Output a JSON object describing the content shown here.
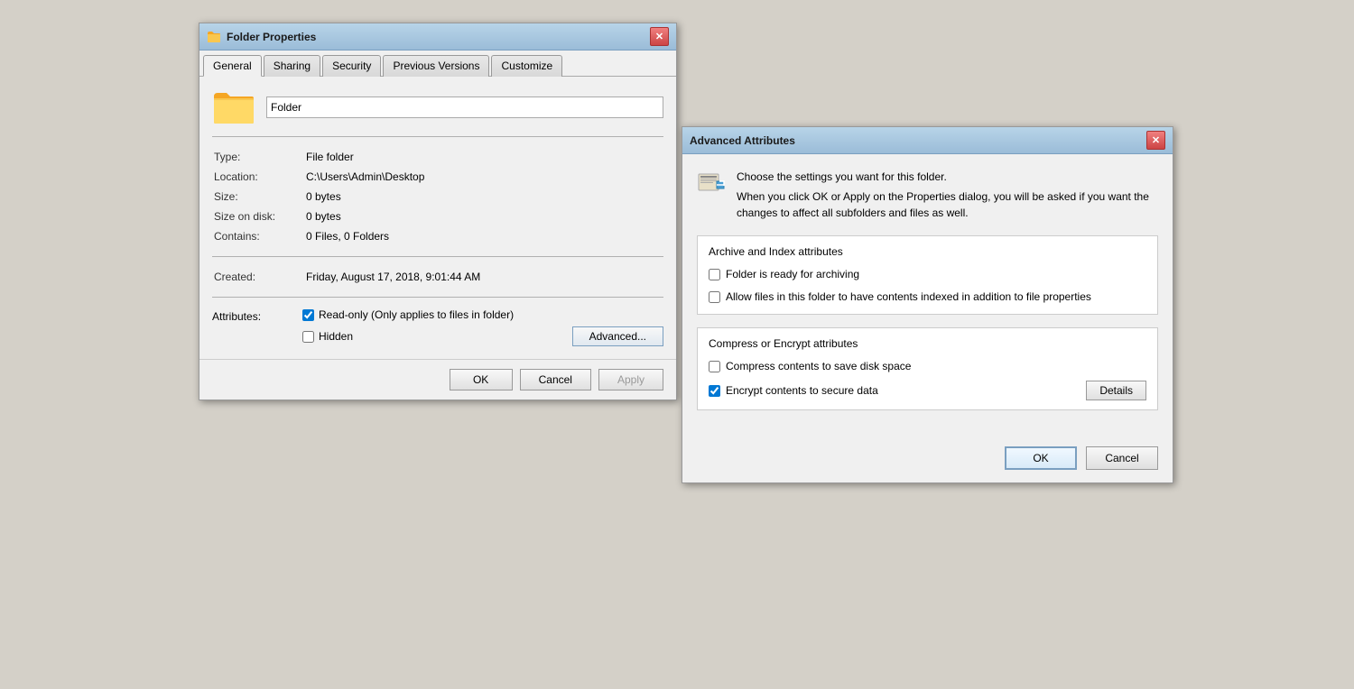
{
  "folderProps": {
    "title": "Folder Properties",
    "tabs": [
      {
        "id": "general",
        "label": "General",
        "active": true
      },
      {
        "id": "sharing",
        "label": "Sharing",
        "active": false
      },
      {
        "id": "security",
        "label": "Security",
        "active": false
      },
      {
        "id": "previous-versions",
        "label": "Previous Versions",
        "active": false
      },
      {
        "id": "customize",
        "label": "Customize",
        "active": false
      }
    ],
    "folderName": "Folder",
    "properties": {
      "type": {
        "label": "Type:",
        "value": "File folder"
      },
      "location": {
        "label": "Location:",
        "value": "C:\\Users\\Admin\\Desktop"
      },
      "size": {
        "label": "Size:",
        "value": "0 bytes"
      },
      "sizeOnDisk": {
        "label": "Size on disk:",
        "value": "0 bytes"
      },
      "contains": {
        "label": "Contains:",
        "value": "0 Files, 0 Folders"
      },
      "created": {
        "label": "Created:",
        "value": "Friday, August 17, 2018, 9:01:44 AM"
      }
    },
    "attributes": {
      "label": "Attributes:",
      "readOnly": {
        "label": "Read-only (Only applies to files in folder)",
        "checked": true
      },
      "hidden": {
        "label": "Hidden",
        "checked": false
      }
    },
    "advancedBtn": "Advanced...",
    "buttons": {
      "ok": "OK",
      "cancel": "Cancel",
      "apply": "Apply"
    }
  },
  "advancedAttrs": {
    "title": "Advanced Attributes",
    "headerText1": "Choose the settings you want for this folder.",
    "headerText2": "When you click OK or Apply on the Properties dialog, you will be asked if you want the changes to affect all subfolders and files as well.",
    "archiveSection": {
      "title": "Archive and Index attributes",
      "items": [
        {
          "label": "Folder is ready for archiving",
          "checked": false
        },
        {
          "label": "Allow files in this folder to have contents indexed in addition to file properties",
          "checked": false
        }
      ]
    },
    "compressSection": {
      "title": "Compress or Encrypt attributes",
      "items": [
        {
          "label": "Compress contents to save disk space",
          "checked": false
        },
        {
          "label": "Encrypt contents to secure data",
          "checked": true
        }
      ]
    },
    "detailsBtn": "Details",
    "buttons": {
      "ok": "OK",
      "cancel": "Cancel"
    }
  }
}
